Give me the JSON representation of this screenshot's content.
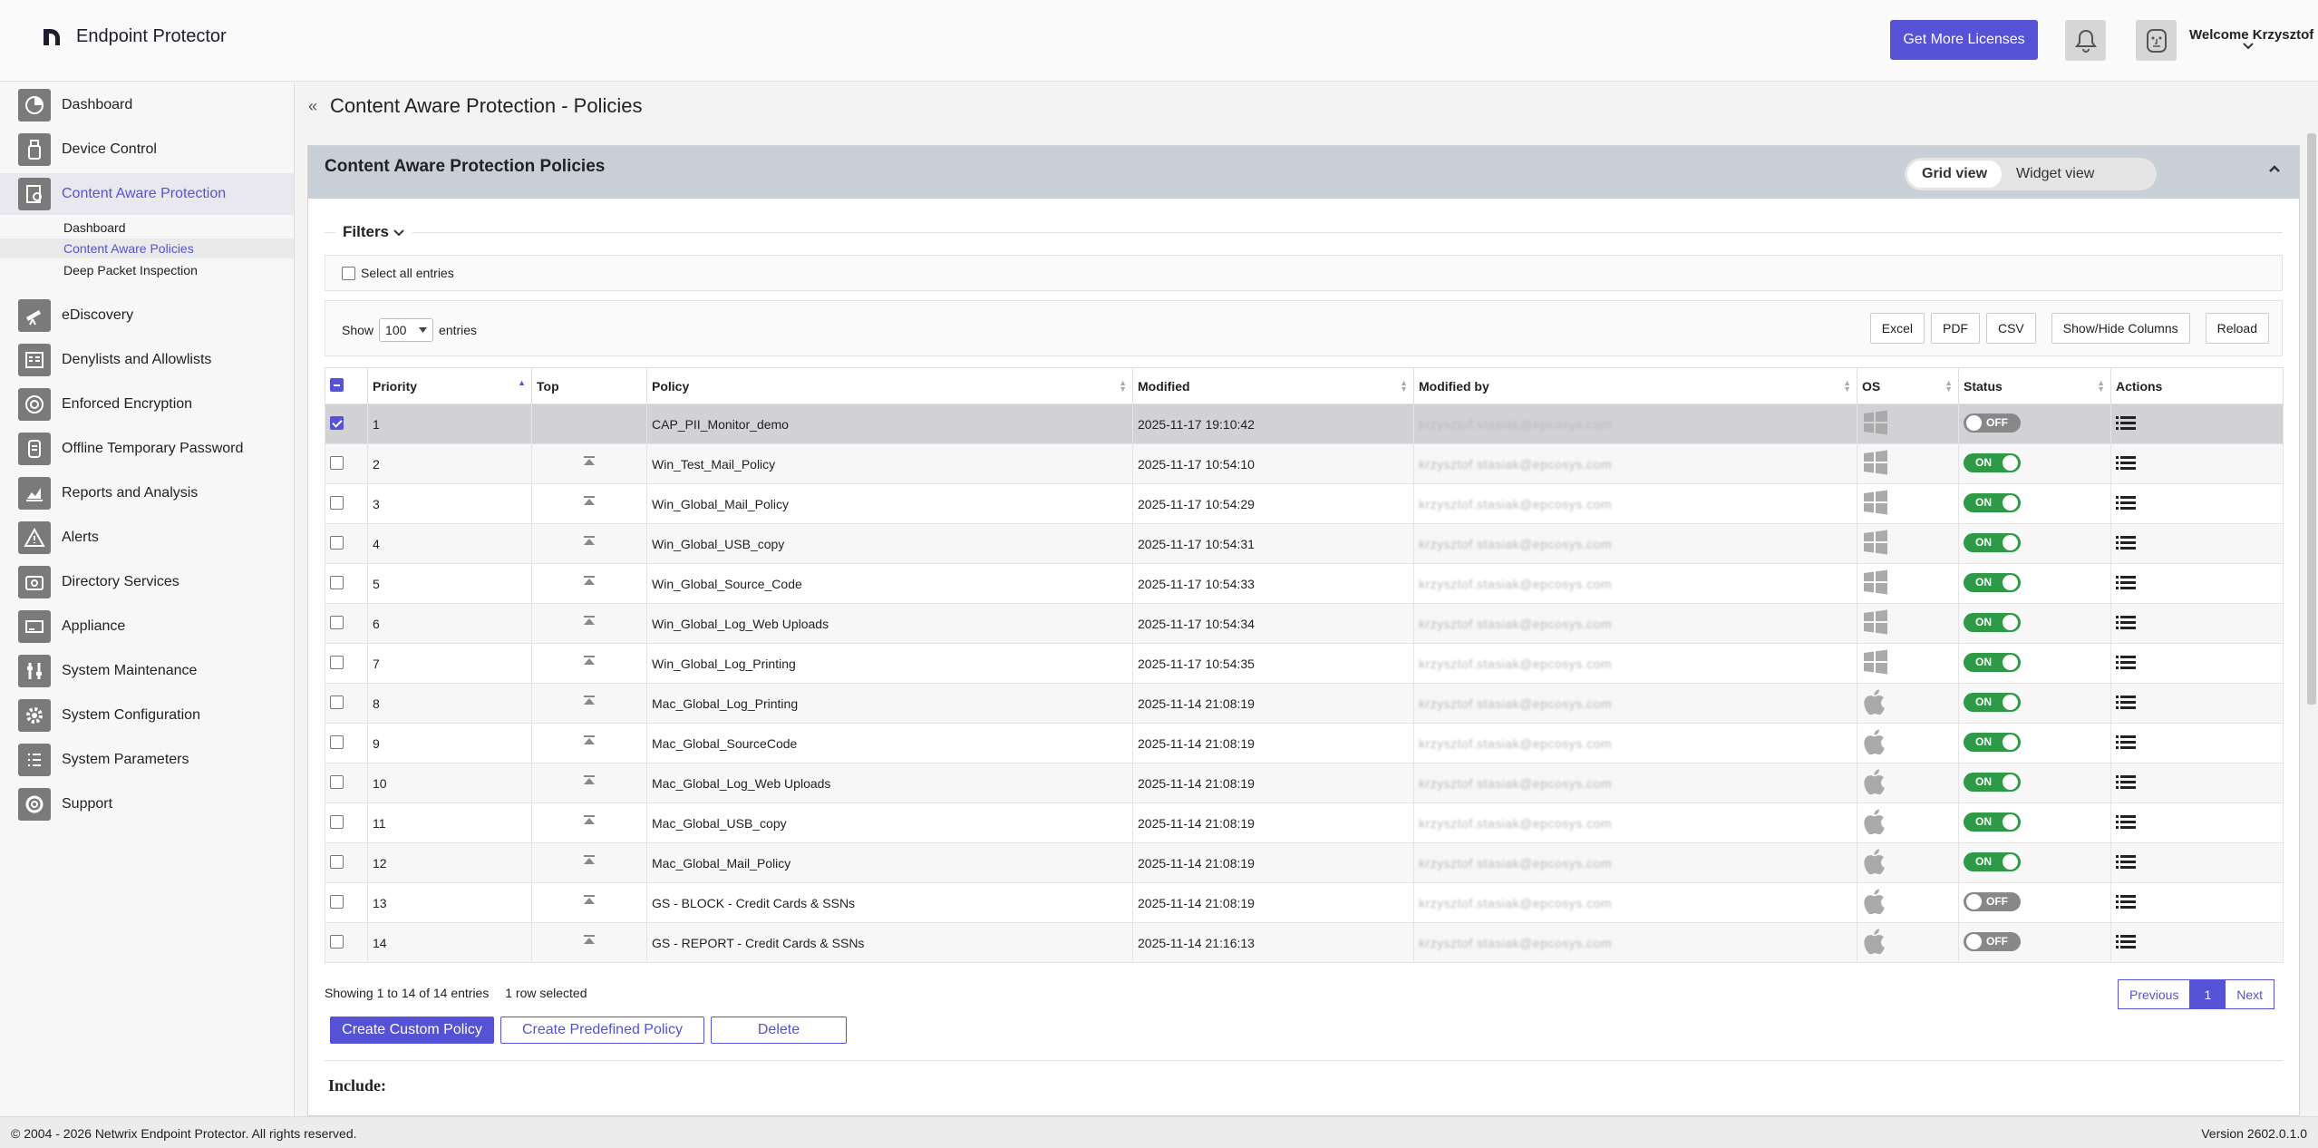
{
  "header": {
    "brand": "Endpoint Protector",
    "licenses_button": "Get More Licenses",
    "welcome": "Welcome Krzysztof",
    "accent_color": "#5552d6"
  },
  "sidebar": {
    "items": [
      {
        "label": "Dashboard",
        "icon": "dashboard-icon"
      },
      {
        "label": "Device Control",
        "icon": "usb-icon"
      },
      {
        "label": "Content Aware Protection",
        "icon": "content-protection-icon",
        "active": true
      },
      {
        "label": "eDiscovery",
        "icon": "telescope-icon"
      },
      {
        "label": "Denylists and Allowlists",
        "icon": "list-icon"
      },
      {
        "label": "Enforced Encryption",
        "icon": "encryption-icon"
      },
      {
        "label": "Offline Temporary Password",
        "icon": "password-icon"
      },
      {
        "label": "Reports and Analysis",
        "icon": "reports-icon"
      },
      {
        "label": "Alerts",
        "icon": "alert-icon"
      },
      {
        "label": "Directory Services",
        "icon": "directory-icon"
      },
      {
        "label": "Appliance",
        "icon": "appliance-icon"
      },
      {
        "label": "System Maintenance",
        "icon": "maintenance-icon"
      },
      {
        "label": "System Configuration",
        "icon": "gear-icon"
      },
      {
        "label": "System Parameters",
        "icon": "parameters-icon"
      },
      {
        "label": "Support",
        "icon": "support-icon"
      }
    ],
    "sub_items": [
      {
        "label": "Dashboard"
      },
      {
        "label": "Content Aware Policies",
        "active": true
      },
      {
        "label": "Deep Packet Inspection"
      }
    ]
  },
  "page": {
    "title": "Content Aware Protection - Policies",
    "panel_title": "Content Aware Protection Policies",
    "grid_view": "Grid view",
    "widget_view": "Widget view",
    "filters": "Filters",
    "select_all": "Select all entries",
    "show": "Show",
    "entries": "entries",
    "page_length": "100",
    "buttons": {
      "excel": "Excel",
      "pdf": "PDF",
      "csv": "CSV",
      "columns": "Show/Hide Columns",
      "reload": "Reload"
    }
  },
  "table": {
    "columns": [
      "Priority",
      "Top",
      "Policy",
      "Modified",
      "Modified by",
      "OS",
      "Status",
      "Actions"
    ],
    "modified_by_mask": "krzysztof.stasiak@epcosys.com",
    "rows": [
      {
        "priority": "1",
        "policy": "CAP_PII_Monitor_demo",
        "modified": "2025-11-17 19:10:42",
        "os": "windows",
        "status": "OFF",
        "selected": true
      },
      {
        "priority": "2",
        "policy": "Win_Test_Mail_Policy",
        "modified": "2025-11-17 10:54:10",
        "os": "windows",
        "status": "ON"
      },
      {
        "priority": "3",
        "policy": "Win_Global_Mail_Policy",
        "modified": "2025-11-17 10:54:29",
        "os": "windows",
        "status": "ON"
      },
      {
        "priority": "4",
        "policy": "Win_Global_USB_copy",
        "modified": "2025-11-17 10:54:31",
        "os": "windows",
        "status": "ON"
      },
      {
        "priority": "5",
        "policy": "Win_Global_Source_Code",
        "modified": "2025-11-17 10:54:33",
        "os": "windows",
        "status": "ON"
      },
      {
        "priority": "6",
        "policy": "Win_Global_Log_Web Uploads",
        "modified": "2025-11-17 10:54:34",
        "os": "windows",
        "status": "ON"
      },
      {
        "priority": "7",
        "policy": "Win_Global_Log_Printing",
        "modified": "2025-11-17 10:54:35",
        "os": "windows",
        "status": "ON"
      },
      {
        "priority": "8",
        "policy": "Mac_Global_Log_Printing",
        "modified": "2025-11-14 21:08:19",
        "os": "mac",
        "status": "ON"
      },
      {
        "priority": "9",
        "policy": "Mac_Global_SourceCode",
        "modified": "2025-11-14 21:08:19",
        "os": "mac",
        "status": "ON"
      },
      {
        "priority": "10",
        "policy": "Mac_Global_Log_Web Uploads",
        "modified": "2025-11-14 21:08:19",
        "os": "mac",
        "status": "ON"
      },
      {
        "priority": "11",
        "policy": "Mac_Global_USB_copy",
        "modified": "2025-11-14 21:08:19",
        "os": "mac",
        "status": "ON"
      },
      {
        "priority": "12",
        "policy": "Mac_Global_Mail_Policy",
        "modified": "2025-11-14 21:08:19",
        "os": "mac",
        "status": "ON"
      },
      {
        "priority": "13",
        "policy": "GS - BLOCK - Credit Cards & SSNs",
        "modified": "2025-11-14 21:08:19",
        "os": "mac",
        "status": "OFF"
      },
      {
        "priority": "14",
        "policy": "GS - REPORT - Credit Cards & SSNs",
        "modified": "2025-11-14 21:16:13",
        "os": "mac",
        "status": "OFF"
      }
    ],
    "info": "Showing 1 to 14 of 14 entries",
    "selected_info": "1 row selected",
    "pager": {
      "previous": "Previous",
      "current": "1",
      "next": "Next"
    }
  },
  "actions": {
    "create_custom": "Create Custom Policy",
    "create_predefined": "Create Predefined Policy",
    "delete": "Delete"
  },
  "include_label": "Include:",
  "footer": {
    "copyright": "© 2004 - 2026 Netwrix Endpoint Protector. All rights reserved.",
    "version": "Version 2602.0.1.0"
  }
}
